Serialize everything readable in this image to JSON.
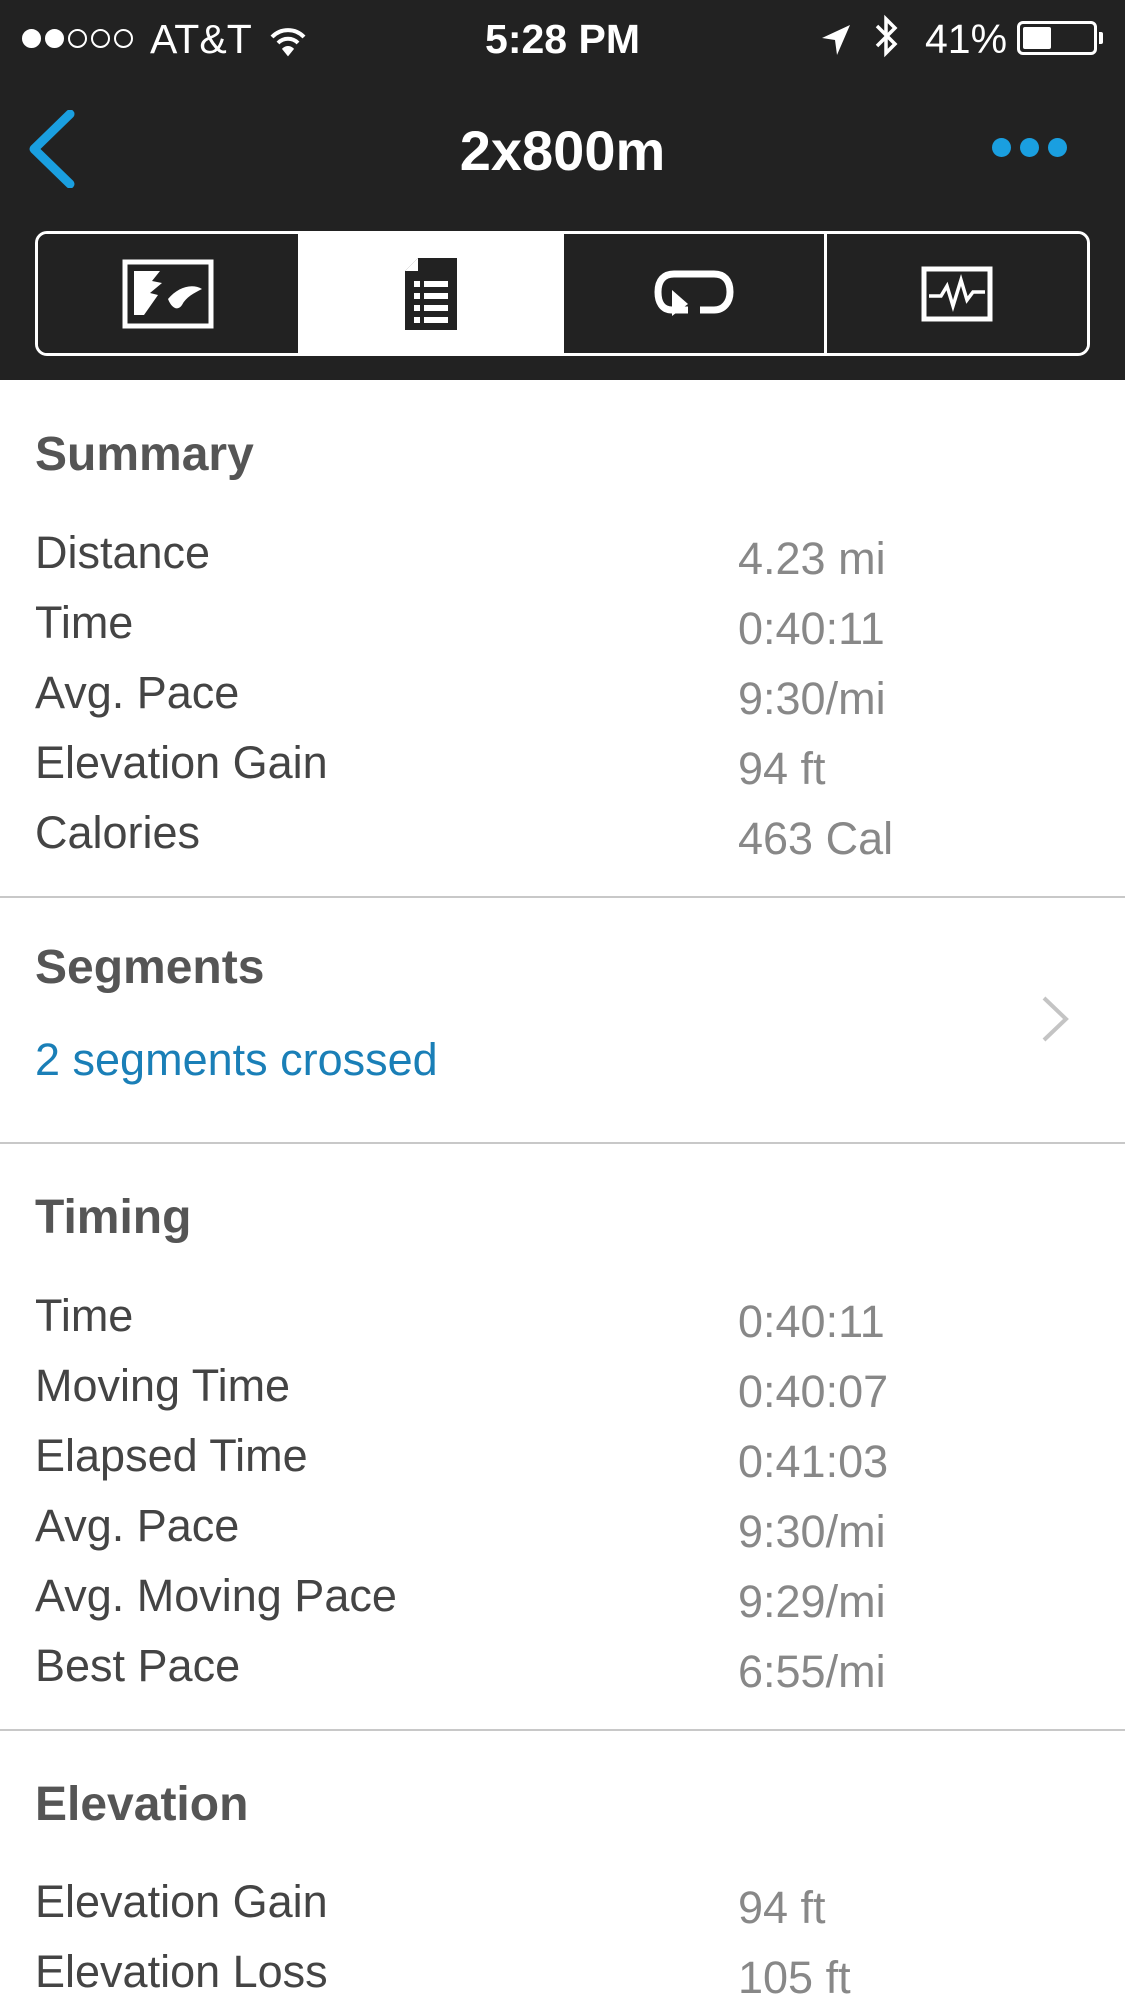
{
  "status_bar": {
    "carrier": "AT&T",
    "time": "5:28 PM",
    "battery": "41%",
    "battery_level": 0.41,
    "signal_bars_filled": 2,
    "signal_bars_total": 5
  },
  "nav": {
    "title": "2x800m",
    "accent_color": "#1a9fe0"
  },
  "tabs": [
    {
      "icon": "map-icon",
      "active": false
    },
    {
      "icon": "document-list-icon",
      "active": true
    },
    {
      "icon": "laps-loop-icon",
      "active": false
    },
    {
      "icon": "chart-pulse-icon",
      "active": false
    }
  ],
  "summary": {
    "title": "Summary",
    "rows": [
      {
        "label": "Distance",
        "value": "4.23 mi"
      },
      {
        "label": "Time",
        "value": "0:40:11"
      },
      {
        "label": "Avg. Pace",
        "value": "9:30/mi"
      },
      {
        "label": "Elevation Gain",
        "value": "94 ft"
      },
      {
        "label": "Calories",
        "value": "463 Cal"
      }
    ]
  },
  "segments": {
    "title": "Segments",
    "link_text": "2 segments crossed"
  },
  "timing": {
    "title": "Timing",
    "rows": [
      {
        "label": "Time",
        "value": "0:40:11"
      },
      {
        "label": "Moving Time",
        "value": "0:40:07"
      },
      {
        "label": "Elapsed Time",
        "value": "0:41:03"
      },
      {
        "label": "Avg. Pace",
        "value": "9:30/mi"
      },
      {
        "label": "Avg. Moving Pace",
        "value": "9:29/mi"
      },
      {
        "label": "Best Pace",
        "value": "6:55/mi"
      }
    ]
  },
  "elevation": {
    "title": "Elevation",
    "rows": [
      {
        "label": "Elevation Gain",
        "value": "94 ft"
      },
      {
        "label": "Elevation Loss",
        "value": "105 ft"
      }
    ]
  }
}
